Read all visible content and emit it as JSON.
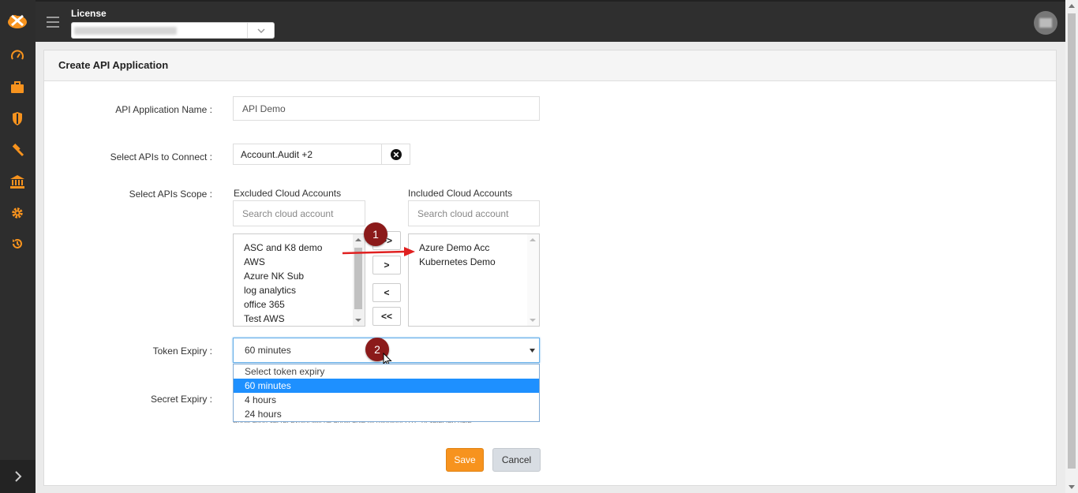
{
  "header": {
    "license_label": "License"
  },
  "page": {
    "title": "Create API Application"
  },
  "form": {
    "name_label": "API Application Name :",
    "name_value": "API Demo",
    "apis_label": "Select APIs to Connect :",
    "apis_value": "Account.Audit +2",
    "scope_label": "Select APIs Scope :",
    "excluded_title": "Excluded Cloud Accounts",
    "included_title": "Included Cloud Accounts",
    "search_placeholder": "Search cloud account",
    "excluded_accounts": [
      "ASC and K8 demo",
      "AWS",
      "Azure NK Sub",
      "log analytics",
      "office 365",
      "Test AWS"
    ],
    "included_accounts": [
      "Azure Demo Acc",
      "Kubernetes Demo"
    ],
    "move_buttons": [
      ">>",
      ">",
      "<",
      "<<"
    ],
    "token_label": "Token Expiry :",
    "token_value": "60 minutes",
    "token_options": [
      "Select token expiry",
      "60 minutes",
      "4 hours",
      "24 hours"
    ],
    "secret_label": "Secret Expiry :",
    "secret_hint": "Application secret expiry will be applicable till midnight UTC of selected date.",
    "save_label": "Save",
    "cancel_label": "Cancel"
  },
  "markers": [
    "1",
    "2"
  ],
  "colors": {
    "accent": "#f7931e",
    "marker": "#8b1a1a",
    "selected": "#1e90ff",
    "sidebar_icons": "#f7931e"
  },
  "icons": {
    "sidebar": [
      "dashboard-icon",
      "briefcase-icon",
      "shield-icon",
      "gavel-icon",
      "bank-icon",
      "gear-icon",
      "history-icon"
    ]
  }
}
